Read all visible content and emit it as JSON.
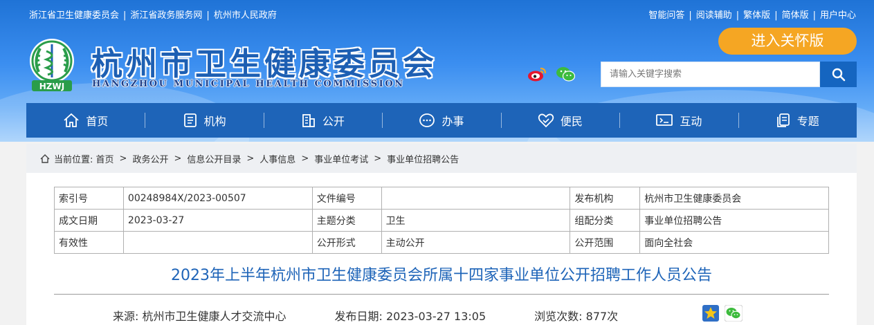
{
  "top_links_left": [
    "浙江省卫生健康委员会",
    "浙江省政务服务网",
    "杭州市人民政府"
  ],
  "top_links_right": [
    "智能问答",
    "阅读辅助",
    "繁体版",
    "简体版",
    "用户中心"
  ],
  "site": {
    "logo_text": "HZWJ",
    "title_cn": "杭州市卫生健康委员会",
    "title_en": "HANGZHOU MUNICIPAL HEALTH COMMISSION"
  },
  "care_button": "进入关怀版",
  "search": {
    "placeholder": "请输入关键字搜索"
  },
  "nav": [
    "首页",
    "机构",
    "公开",
    "办事",
    "便民",
    "互动",
    "专题"
  ],
  "breadcrumb": {
    "prefix": "当前位置:",
    "items": [
      "首页",
      "政务公开",
      "信息公开目录",
      "人事信息",
      "事业单位考试",
      "事业单位招聘公告"
    ]
  },
  "meta_table": [
    [
      "索引号",
      "00248984X/2023-00507",
      "文件编号",
      "",
      "发布机构",
      "杭州市卫生健康委员会"
    ],
    [
      "成文日期",
      "2023-03-27",
      "主题分类",
      "卫生",
      "组配分类",
      "事业单位招聘公告"
    ],
    [
      "有效性",
      "",
      "公开形式",
      "主动公开",
      "公开范围",
      "面向全社会"
    ]
  ],
  "article": {
    "title": "2023年上半年杭州市卫生健康委员会所属十四家事业单位公开招聘工作人员公告",
    "source": "来源:   杭州市卫生健康人才交流中心",
    "publish_date": "发布日期:   2023-03-27 13:05",
    "views": "浏览次数:   877次"
  },
  "colors": {
    "nav_bg": "#1e64b8",
    "care_button": "#f5a623",
    "title_blue": "#1e64b8"
  }
}
